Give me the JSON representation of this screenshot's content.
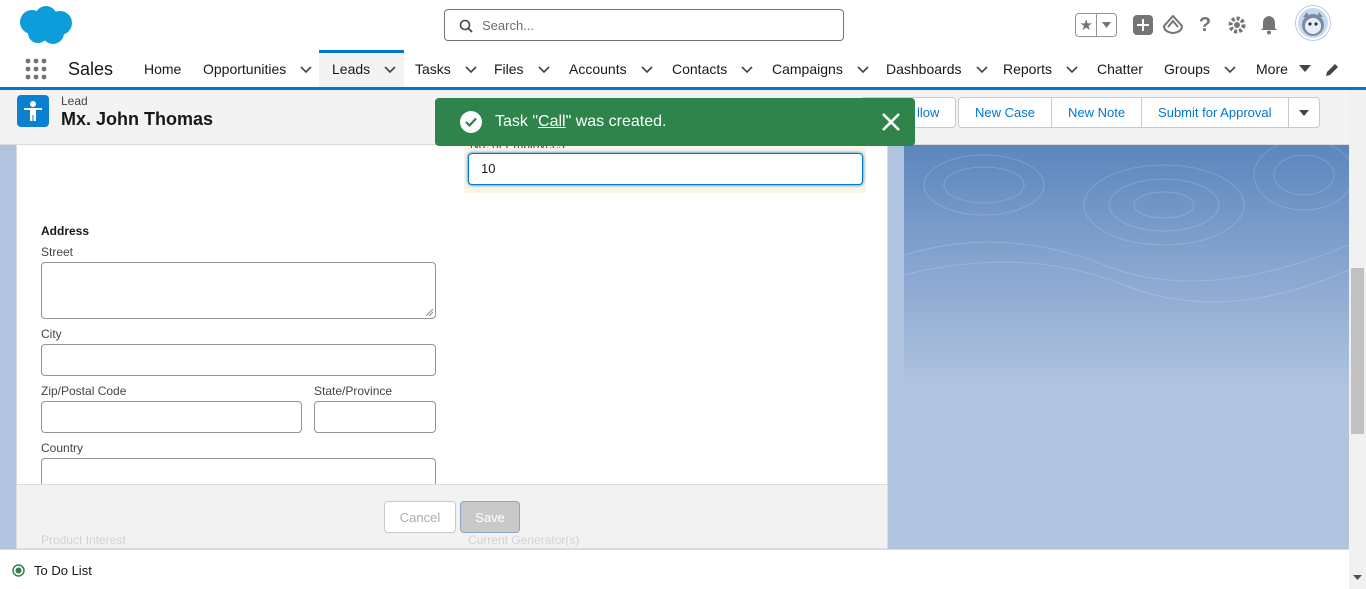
{
  "header": {
    "search_placeholder": "Search...",
    "icons": [
      "salesforce-cloud-logo",
      "search-icon",
      "favorites-star-icon",
      "add-icon",
      "trailhead-icon",
      "help-icon",
      "setup-gear-icon",
      "notifications-bell-icon",
      "user-avatar"
    ]
  },
  "nav": {
    "app_name": "Sales",
    "items": [
      {
        "label": "Home",
        "has_menu": false
      },
      {
        "label": "Opportunities",
        "has_menu": true
      },
      {
        "label": "Leads",
        "has_menu": true,
        "active": true
      },
      {
        "label": "Tasks",
        "has_menu": true
      },
      {
        "label": "Files",
        "has_menu": true
      },
      {
        "label": "Accounts",
        "has_menu": true
      },
      {
        "label": "Contacts",
        "has_menu": true
      },
      {
        "label": "Campaigns",
        "has_menu": true
      },
      {
        "label": "Dashboards",
        "has_menu": true
      },
      {
        "label": "Reports",
        "has_menu": true
      },
      {
        "label": "Chatter",
        "has_menu": false
      },
      {
        "label": "Groups",
        "has_menu": true
      },
      {
        "label": "More",
        "has_menu": true
      }
    ]
  },
  "record": {
    "object_label": "Lead",
    "name": "Mx. John Thomas",
    "actions": {
      "follow": "llow",
      "new_case": "New Case",
      "new_note": "New Note",
      "submit": "Submit for Approval"
    }
  },
  "toast": {
    "prefix": "Task \"",
    "link": "Call",
    "suffix": "\" was created.",
    "color": "#2e844a"
  },
  "form": {
    "employees_label": "No. of Employees",
    "employees_value": "10",
    "address_heading": "Address",
    "street_label": "Street",
    "city_label": "City",
    "zip_label": "Zip/Postal Code",
    "state_label": "State/Province",
    "country_label": "Country",
    "product_interest_label": "Product Interest",
    "current_generators_label": "Current Generator(s)",
    "cancel_label": "Cancel",
    "save_label": "Save"
  },
  "utility": {
    "todo_label": "To Do List"
  },
  "colors": {
    "brand": "#0176d3",
    "success": "#2e844a",
    "banner": "#b0c4df"
  }
}
